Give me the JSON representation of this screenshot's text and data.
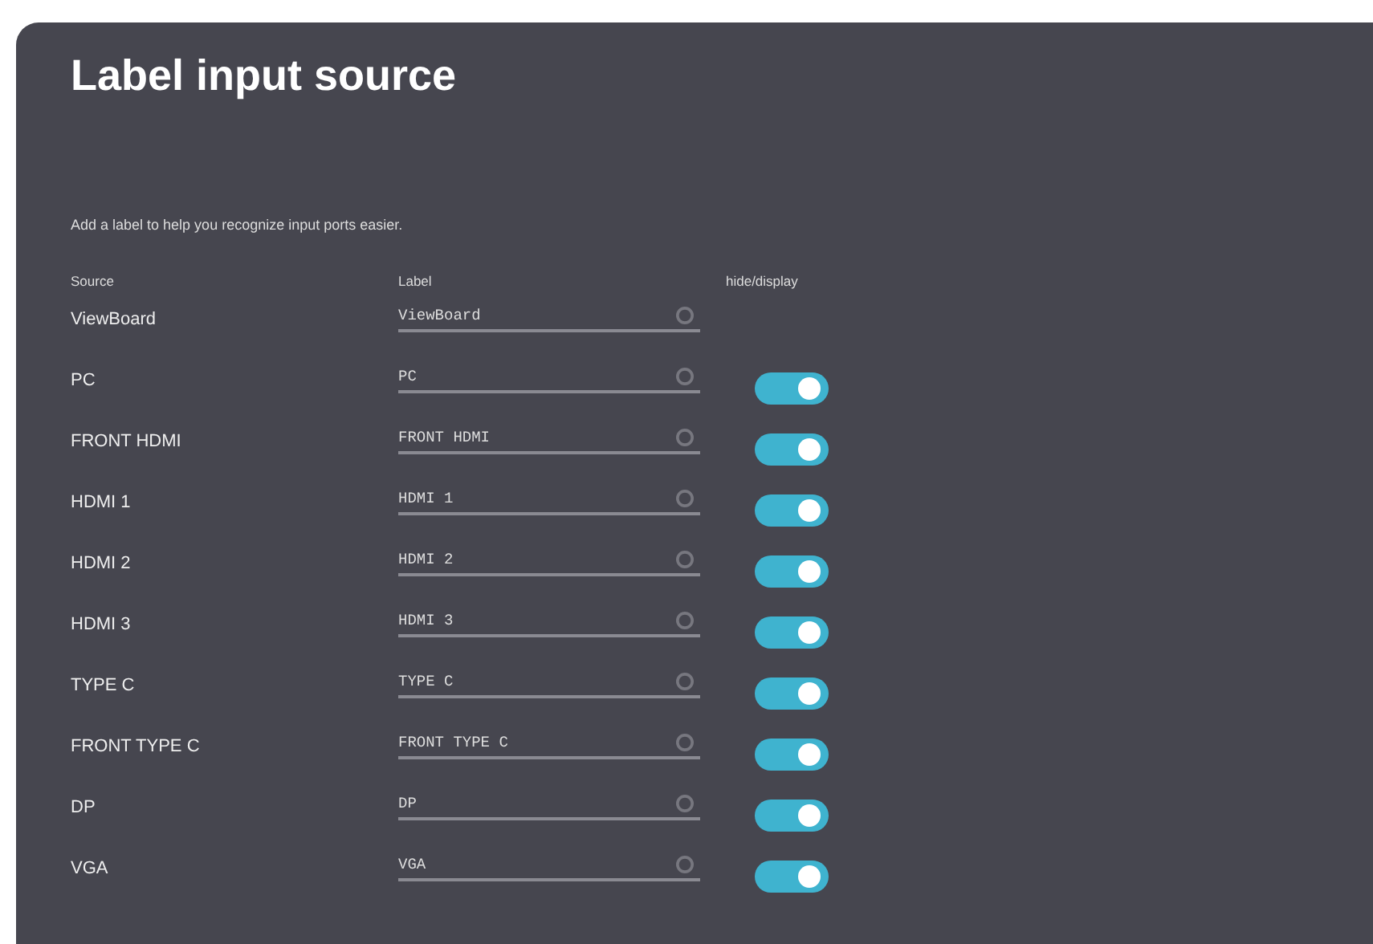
{
  "title": "Label input source",
  "description": "Add a label to help you recognize input ports easier.",
  "columns": [
    "Source",
    "Label",
    "hide/display"
  ],
  "rows": [
    {
      "kind": "fixed",
      "source": "ViewBoard",
      "label": "ViewBoard"
    },
    {
      "kind": "toggle",
      "source": "PC",
      "label": "PC",
      "on": true
    },
    {
      "kind": "toggle",
      "source": "FRONT HDMI",
      "label": "FRONT HDMI",
      "on": true
    },
    {
      "kind": "toggle",
      "source": "HDMI 1",
      "label": "HDMI 1",
      "on": true
    },
    {
      "kind": "toggle",
      "source": "HDMI 2",
      "label": "HDMI 2",
      "on": true
    },
    {
      "kind": "toggle",
      "source": "HDMI 3",
      "label": "HDMI 3",
      "on": true
    },
    {
      "kind": "toggle",
      "source": "TYPE C",
      "label": "TYPE C",
      "on": true
    },
    {
      "kind": "toggle",
      "source": "FRONT TYPE C",
      "label": "FRONT TYPE C",
      "on": true
    },
    {
      "kind": "toggle",
      "source": "DP",
      "label": "DP",
      "on": true
    },
    {
      "kind": "toggle",
      "source": "VGA",
      "label": "VGA",
      "on": true
    }
  ]
}
